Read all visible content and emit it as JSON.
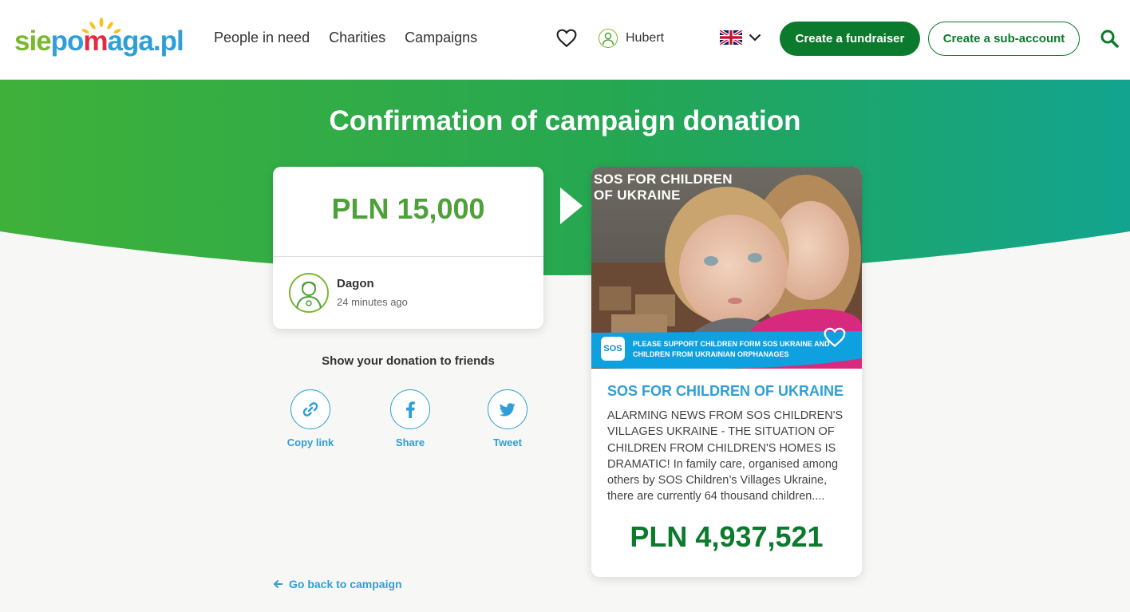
{
  "header": {
    "logo": {
      "part1": "sie",
      "part2": "po",
      "part3": "m",
      "part4": "aga.pl"
    },
    "nav": [
      "People in need",
      "Charities",
      "Campaigns"
    ],
    "user_name": "Hubert",
    "create_fundraiser": "Create a fundraiser",
    "create_sub_account": "Create a sub-account"
  },
  "page": {
    "title": "Confirmation of campaign donation"
  },
  "donation": {
    "amount": "PLN 15,000",
    "donor_name": "Dagon",
    "time_ago": "24 minutes ago"
  },
  "share": {
    "title": "Show your donation to friends",
    "items": [
      "Copy link",
      "Share",
      "Tweet"
    ]
  },
  "back_link": "Go back to campaign",
  "campaign": {
    "image_title": "SOS FOR CHILDREN OF UKRAINE",
    "image_strip": "PLEASE SUPPORT CHILDREN FORM SOS UKRAINE AND CHILDREN FROM UKRAINIAN ORPHANAGES",
    "badge": "SOS",
    "title": "SOS FOR CHILDREN OF UKRAINE",
    "description": "ALARMING NEWS FROM SOS CHILDREN'S VILLAGES UKRAINE - THE SITUATION OF CHILDREN FROM CHILDREN'S HOMES IS DRAMATIC! In family care, organised among others by SOS Children’s Villages Ukraine, there are currently 64 thousand children....",
    "amount": "PLN 4,937,521"
  },
  "colors": {
    "brand_green": "#0b7a2d",
    "amount_green": "#4ea13a",
    "link_blue": "#2f9fd6",
    "banner_start": "#3fb13a",
    "banner_end": "#12a48f"
  },
  "icons": [
    "heart-icon",
    "user-avatar-icon",
    "uk-flag-icon",
    "chevron-down-icon",
    "search-icon",
    "link-icon",
    "facebook-icon",
    "twitter-icon",
    "arrow-left-icon",
    "play-arrow-icon"
  ]
}
